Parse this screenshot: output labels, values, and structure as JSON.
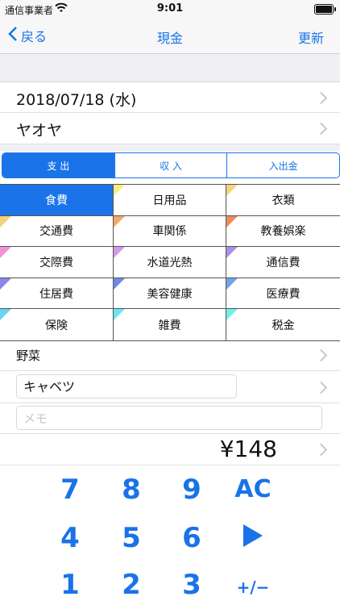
{
  "status": {
    "carrier": "通信事業者",
    "time": "9:01"
  },
  "nav": {
    "back": "戻る",
    "title": "現金",
    "update": "更新"
  },
  "date": "2018/07/18 (水)",
  "payee": "ヤオヤ",
  "segments": [
    {
      "label": "支 出",
      "selected": true
    },
    {
      "label": "収 入",
      "selected": false
    },
    {
      "label": "入出金",
      "selected": false
    }
  ],
  "categories": [
    {
      "label": "食費",
      "color": "#ffffff",
      "selected": true
    },
    {
      "label": "日用品",
      "color": "#f6ef7b",
      "selected": false
    },
    {
      "label": "衣類",
      "color": "#f3d57c",
      "selected": false
    },
    {
      "label": "交通費",
      "color": "#f6cf7c",
      "selected": false
    },
    {
      "label": "車関係",
      "color": "#f5a863",
      "selected": false
    },
    {
      "label": "教養娯楽",
      "color": "#f08a5d",
      "selected": false
    },
    {
      "label": "交際費",
      "color": "#f590d8",
      "selected": false
    },
    {
      "label": "水道光熱",
      "color": "#d39ae9",
      "selected": false
    },
    {
      "label": "通信費",
      "color": "#ac8ee8",
      "selected": false
    },
    {
      "label": "住居費",
      "color": "#8b86e6",
      "selected": false
    },
    {
      "label": "美容健康",
      "color": "#6f89e4",
      "selected": false
    },
    {
      "label": "医療費",
      "color": "#6fa4e8",
      "selected": false
    },
    {
      "label": "保険",
      "color": "#67d5ef",
      "selected": false
    },
    {
      "label": "雑費",
      "color": "#67e8f0",
      "selected": false
    },
    {
      "label": "税金",
      "color": "#6ff0e8",
      "selected": false
    }
  ],
  "subcategory": "野菜",
  "item_name": "キャベツ",
  "memo_placeholder": "メモ",
  "amount": "¥148",
  "keypad": {
    "row1": [
      "7",
      "8",
      "9",
      "AC"
    ],
    "row2": [
      "4",
      "5",
      "6"
    ],
    "row3": [
      "1",
      "2",
      "3",
      "+/−"
    ]
  },
  "colors": {
    "accent": "#1a73e8"
  }
}
